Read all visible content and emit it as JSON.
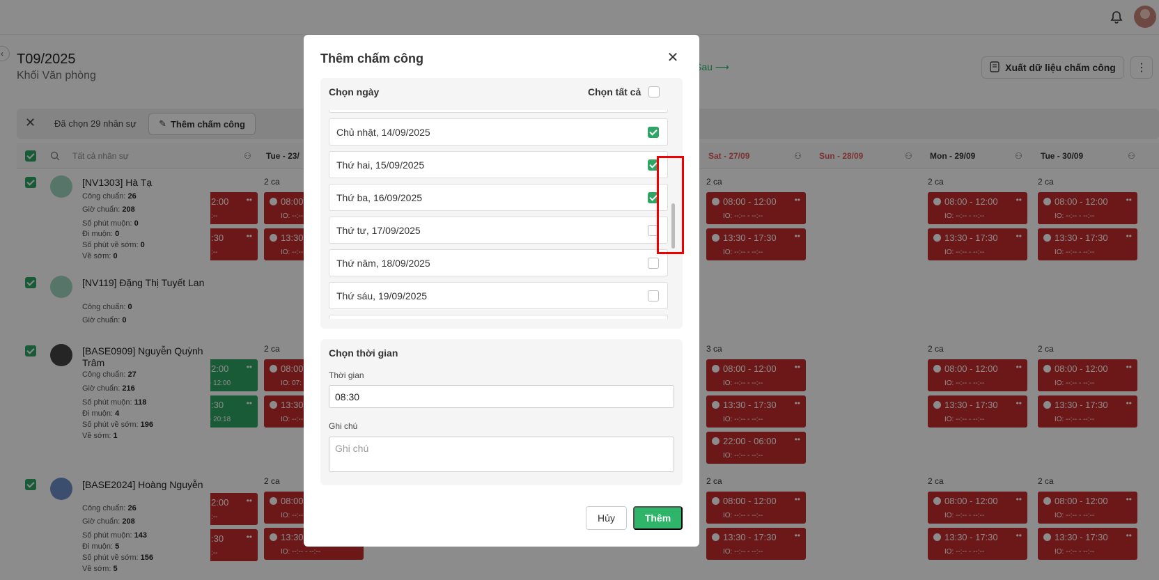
{
  "header": {
    "title": "T09/2025",
    "subtitle": "Khối Văn phòng",
    "next_label": "Sau ⟶",
    "export_label": "Xuất dữ liệu chấm công",
    "more_icon": "⋮"
  },
  "selection_bar": {
    "count_text": "Đã chọn 29 nhân sự",
    "add_label": "Thêm chấm công"
  },
  "grid": {
    "search_placeholder": "Tất cả nhân sự",
    "columns": [
      {
        "label": "Tue - 23/"
      },
      {
        "label": "Sat - 27/09"
      },
      {
        "label": "Sun - 28/09"
      },
      {
        "label": "Mon - 29/09"
      },
      {
        "label": "Tue - 30/09"
      }
    ]
  },
  "employees": [
    {
      "name": "[NV1303] Hà Tạ",
      "stats": [
        [
          "Công chuẩn:",
          "26"
        ],
        [
          "Giờ chuẩn:",
          "208"
        ],
        [
          "Số phút muộn:",
          "0"
        ],
        [
          "Đi muộn:",
          "0"
        ],
        [
          "Số phút về sớm:",
          "0"
        ],
        [
          "Về sớm:",
          "0"
        ]
      ]
    },
    {
      "name": "[NV119] Đặng Thị Tuyết Lan",
      "stats": [
        [
          "Công chuẩn:",
          "0"
        ],
        [
          "Giờ chuẩn:",
          "0"
        ]
      ]
    },
    {
      "name": "[BASE0909] Nguyễn Quỳnh Trâm",
      "stats": [
        [
          "Công chuẩn:",
          "27"
        ],
        [
          "Giờ chuẩn:",
          "216"
        ],
        [
          "Số phút muộn:",
          "118"
        ],
        [
          "Đi muộn:",
          "4"
        ],
        [
          "Số phút về sớm:",
          "196"
        ],
        [
          "Về sớm:",
          "1"
        ]
      ]
    },
    {
      "name": "[BASE2024] Hoàng Nguyễn",
      "stats": [
        [
          "Công chuẩn:",
          "26"
        ],
        [
          "Giờ chuẩn:",
          "208"
        ],
        [
          "Số phút muộn:",
          "143"
        ],
        [
          "Đi muộn:",
          "5"
        ],
        [
          "Số phút về sớm:",
          "156"
        ],
        [
          "Về sớm:",
          "5"
        ]
      ]
    }
  ],
  "shifts": {
    "count_2": "2 ca",
    "count_3": "3 ca",
    "morning": "08:00 - 12:00",
    "afternoon": "13:30 - 17:30",
    "night": "22:00 - 06:00",
    "io_empty": "IO: --:-- - --:--",
    "partial_morning": "2:00",
    "partial_afternoon": ":30",
    "partial_io": ":--",
    "green_io1": "- 12:00",
    "green_io2": "- 20:18",
    "clip_morning": "08:00",
    "clip_afternoon": "13:30",
    "clip_io": "IO: --:--",
    "clip_io2": "IO: 07:"
  },
  "modal": {
    "title": "Thêm chấm công",
    "day_section": {
      "title": "Chọn ngày",
      "select_all": "Chọn tất cả",
      "days": [
        {
          "label": "Chủ nhật, 14/09/2025",
          "checked": true
        },
        {
          "label": "Thứ hai, 15/09/2025",
          "checked": true
        },
        {
          "label": "Thứ ba, 16/09/2025",
          "checked": true
        },
        {
          "label": "Thứ tư, 17/09/2025",
          "checked": false
        },
        {
          "label": "Thứ năm, 18/09/2025",
          "checked": false
        },
        {
          "label": "Thứ sáu, 19/09/2025",
          "checked": false
        }
      ]
    },
    "time_section": {
      "title": "Chọn thời gian",
      "time_label": "Thời gian",
      "time_value": "08:30",
      "note_label": "Ghi chú",
      "note_placeholder": "Ghi chú"
    },
    "cancel_label": "Hủy",
    "submit_label": "Thêm"
  },
  "colors": {
    "accent": "#2fb56a",
    "shift_red": "#c62d2d",
    "highlight": "#e00000",
    "weekend_text": "#e05a5a"
  }
}
